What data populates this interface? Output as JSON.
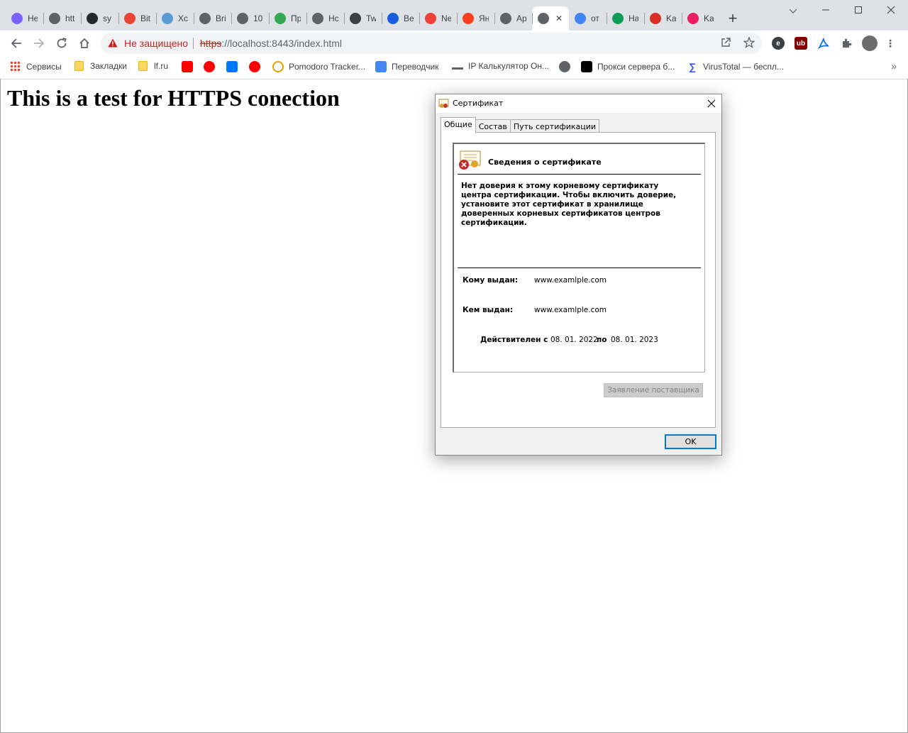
{
  "tabs": [
    {
      "title": "Не",
      "icon": "multicolor-flower-icon",
      "color": "#7b61ff"
    },
    {
      "title": "htt",
      "icon": "globe-icon",
      "color": "#5f6368"
    },
    {
      "title": "sy",
      "icon": "github-icon",
      "color": "#24292e"
    },
    {
      "title": "Bit",
      "icon": "bitwarden-rainbow-icon",
      "color": "#ea4335"
    },
    {
      "title": "Хс",
      "icon": "gear-box-icon",
      "color": "#5b9bd5"
    },
    {
      "title": "Bri",
      "icon": "shield-icon",
      "color": "#5f6368"
    },
    {
      "title": "10",
      "icon": "globe-icon",
      "color": "#5f6368"
    },
    {
      "title": "Пр",
      "icon": "google-play-icon",
      "color": "#34a853"
    },
    {
      "title": "Нс",
      "icon": "chrome-icon",
      "color": "#5f6368"
    },
    {
      "title": "Tw",
      "icon": "shield-icon",
      "color": "#3c4043"
    },
    {
      "title": "Ве",
      "icon": "bitwarden-icon",
      "color": "#175ddc"
    },
    {
      "title": "Ne",
      "icon": "gmail-icon",
      "color": "#ea4335"
    },
    {
      "title": "Ян",
      "icon": "yandex-icon",
      "color": "#fc3f1d"
    },
    {
      "title": "Ар",
      "icon": "globe-icon",
      "color": "#5f6368"
    },
    {
      "title": "",
      "icon": "globe-icon",
      "color": "#5f6368",
      "active": true
    },
    {
      "title": "от",
      "icon": "google-icon",
      "color": "#4285f4"
    },
    {
      "title": "На",
      "icon": "hexagon-icon",
      "color": "#0f9d58"
    },
    {
      "title": "Ka",
      "icon": "book-icon",
      "color": "#d93025"
    },
    {
      "title": "Ka",
      "icon": "c-logo-icon",
      "color": "#e91e63"
    }
  ],
  "toolbar": {
    "security_label": "Не защищено",
    "url_scheme": "https",
    "url_rest": "://localhost:8443/index.html"
  },
  "bookmarks": [
    {
      "label": "Сервисы",
      "icon": "apps-grid-icon",
      "color": "#ea4335"
    },
    {
      "label": "Закладки",
      "icon": "folder-icon",
      "color": "#fdd663"
    },
    {
      "label": "lf.ru",
      "icon": "folder-icon",
      "color": "#fdd663"
    },
    {
      "label": "",
      "icon": "youtube-icon",
      "color": "#ff0000"
    },
    {
      "label": "",
      "icon": "music-icon",
      "color": "#ff0000"
    },
    {
      "label": "",
      "icon": "vk-icon",
      "color": "#0077ff"
    },
    {
      "label": "",
      "icon": "alert-icon",
      "color": "#f00"
    },
    {
      "label": "Pomodoro Tracker...",
      "icon": "tomato-icon",
      "color": "#e8a200"
    },
    {
      "label": "Переводчик",
      "icon": "translate-icon",
      "color": "#4285f4"
    },
    {
      "label": "IP Калькулятор Он...",
      "icon": "router-icon",
      "color": "#5f6368"
    },
    {
      "label": "",
      "icon": "globe-icon",
      "color": "#5f6368"
    },
    {
      "label": "Прокси сервера б...",
      "icon": "terminal-icon",
      "color": "#000000"
    },
    {
      "label": "VirusTotal — беспл...",
      "icon": "virustotal-icon",
      "color": "#394eff"
    }
  ],
  "page": {
    "heading": "This is a test for HTTPS conection"
  },
  "dialog": {
    "title": "Сертификат",
    "tabs": [
      "Общие",
      "Состав",
      "Путь сертификации"
    ],
    "info_heading": "Сведения о сертификате",
    "warning": "Нет доверия к этому корневому сертификату центра сертификации. Чтобы включить  доверие, установите этот сертификат в хранилище доверенных корневых сертификатов центров сертификации.",
    "issued_to_label": "Кому выдан:",
    "issued_to_value": "www.examlple.com",
    "issued_by_label": "Кем выдан:",
    "issued_by_value": "www.examlple.com",
    "valid_from_label": "Действителен с",
    "valid_from": "08. 01. 2022",
    "valid_to_label": "по",
    "valid_to": "08. 01. 2023",
    "issuer_statement_button": "Заявление поставщика",
    "ok_button": "OK"
  }
}
